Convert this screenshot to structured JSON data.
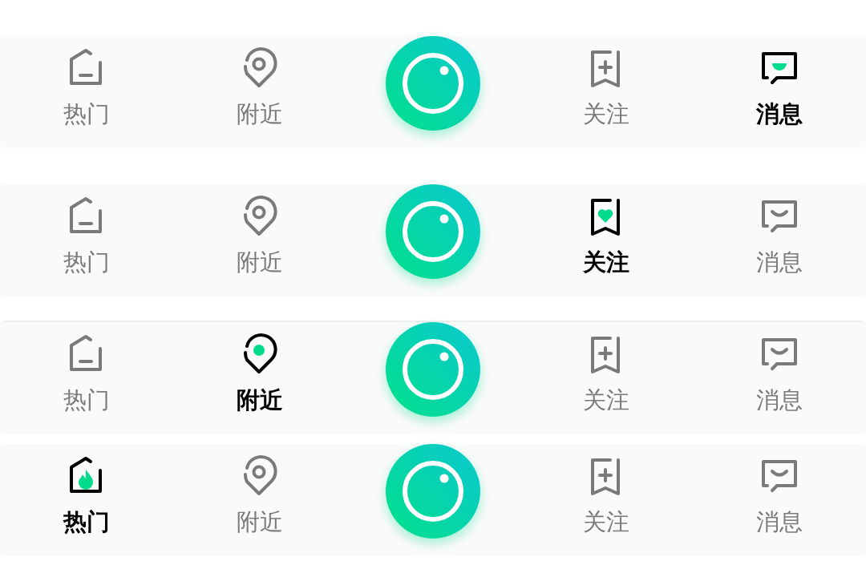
{
  "tab_bars": [
    {
      "tabs": [
        {
          "label": "热门",
          "kind": "home",
          "selected": false
        },
        {
          "label": "附近",
          "kind": "pin",
          "selected": false
        },
        {
          "label": "关注",
          "kind": "bookmark",
          "selected": false
        },
        {
          "label": "消息",
          "kind": "chat",
          "selected": true
        }
      ]
    },
    {
      "tabs": [
        {
          "label": "热门",
          "kind": "home",
          "selected": false
        },
        {
          "label": "附近",
          "kind": "pin",
          "selected": false
        },
        {
          "label": "关注",
          "kind": "bookmark",
          "selected": true
        },
        {
          "label": "消息",
          "kind": "chat",
          "selected": false
        }
      ]
    },
    {
      "tabs": [
        {
          "label": "热门",
          "kind": "home",
          "selected": false
        },
        {
          "label": "附近",
          "kind": "pin",
          "selected": true
        },
        {
          "label": "关注",
          "kind": "bookmark",
          "selected": false
        },
        {
          "label": "消息",
          "kind": "chat",
          "selected": false
        }
      ]
    },
    {
      "tabs": [
        {
          "label": "热门",
          "kind": "home",
          "selected": true
        },
        {
          "label": "附近",
          "kind": "pin",
          "selected": false
        },
        {
          "label": "关注",
          "kind": "bookmark",
          "selected": false
        },
        {
          "label": "消息",
          "kind": "chat",
          "selected": false
        }
      ]
    }
  ]
}
